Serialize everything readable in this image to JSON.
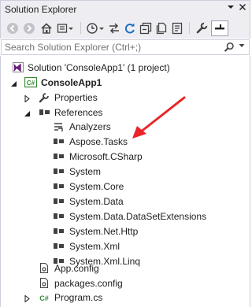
{
  "window": {
    "title": "Solution Explorer"
  },
  "search": {
    "placeholder": "Search Solution Explorer (Ctrl+;)"
  },
  "tree": {
    "solution_label": "Solution 'ConsoleApp1' (1 project)",
    "project_label": "ConsoleApp1",
    "properties_label": "Properties",
    "references_label": "References",
    "references": [
      "Analyzers",
      "Aspose.Tasks",
      "Microsoft.CSharp",
      "System",
      "System.Core",
      "System.Data",
      "System.Data.DataSetExtensions",
      "System.Net.Http",
      "System.Xml",
      "System.Xml.Linq"
    ],
    "files": [
      "App.config",
      "packages.config",
      "Program.cs"
    ]
  },
  "annotation": {
    "arrow_color": "#e8262a"
  }
}
